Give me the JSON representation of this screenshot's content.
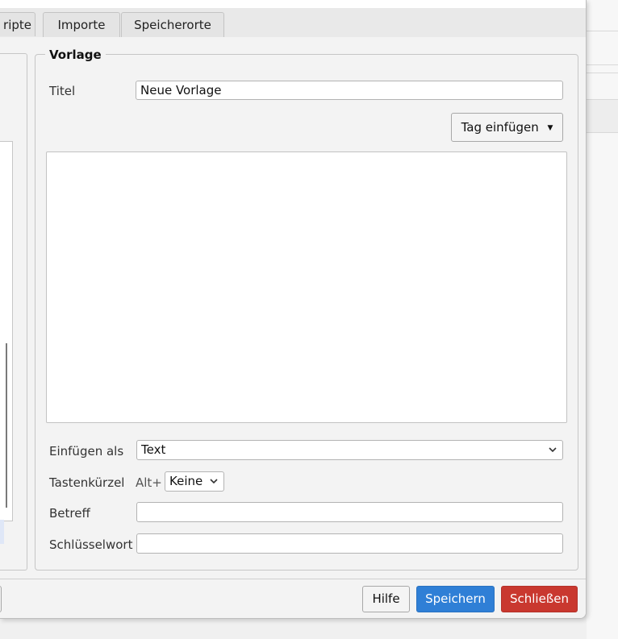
{
  "tabs": [
    {
      "label": "ripte"
    },
    {
      "label": "Importe"
    },
    {
      "label": "Speicherorte"
    }
  ],
  "vorlage": {
    "legend": "Vorlage",
    "title_label": "Titel",
    "title_value": "Neue Vorlage",
    "insert_tag_button": "Tag einfügen",
    "insert_tag_arrow": "▼",
    "body_text": "",
    "insert_as_label": "Einfügen als",
    "insert_as_value": "Text",
    "shortcut_label": "Tastenkürzel",
    "shortcut_prefix": "Alt+",
    "shortcut_value": "Keine",
    "subject_label": "Betreff",
    "subject_value": "",
    "keyword_label": "Schlüsselwort",
    "keyword_value": ""
  },
  "footer": {
    "help_label": "Hilfe",
    "save_label": "Speichern",
    "close_label": "Schließen"
  },
  "colors": {
    "save_button": "#2f7fd6",
    "close_button": "#c9382f"
  }
}
